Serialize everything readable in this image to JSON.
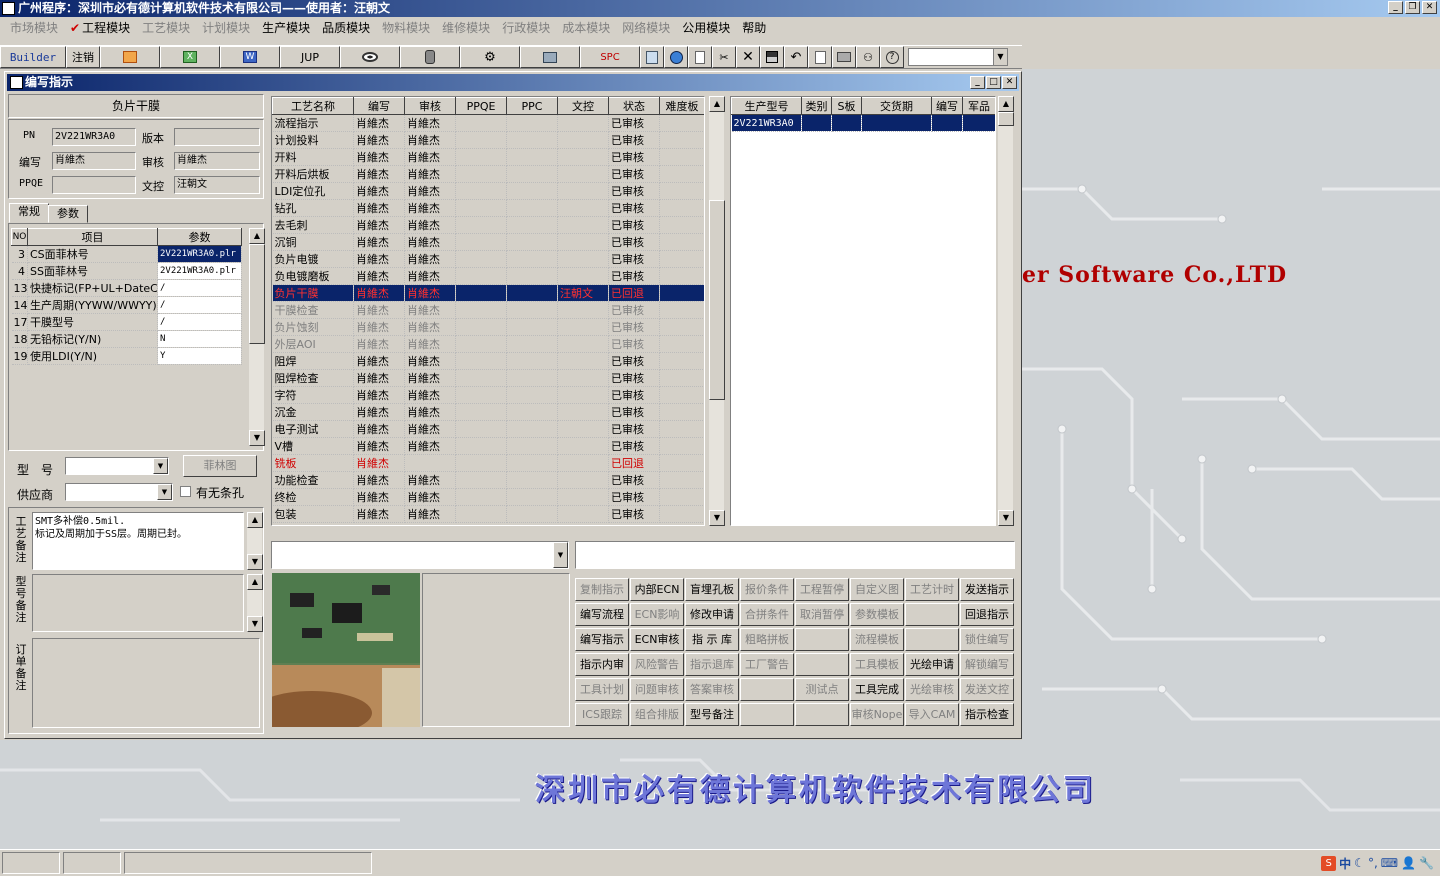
{
  "app": {
    "title": "广州程序：深圳市必有德计算机软件技术有限公司——使用者：汪朝文"
  },
  "menubar": [
    {
      "label": "市场模块",
      "enabled": false
    },
    {
      "label": "工程模块",
      "enabled": true,
      "checked": true
    },
    {
      "label": "工艺模块",
      "enabled": false
    },
    {
      "label": "计划模块",
      "enabled": false
    },
    {
      "label": "生产模块",
      "enabled": true
    },
    {
      "label": "品质模块",
      "enabled": true
    },
    {
      "label": "物料模块",
      "enabled": false
    },
    {
      "label": "维修模块",
      "enabled": false
    },
    {
      "label": "行政模块",
      "enabled": false
    },
    {
      "label": "成本模块",
      "enabled": false
    },
    {
      "label": "网络模块",
      "enabled": false
    },
    {
      "label": "公用模块",
      "enabled": true
    },
    {
      "label": "帮助",
      "enabled": true
    }
  ],
  "toolbar": {
    "builder": "Builder",
    "logout": "注销",
    "jup": "JUP",
    "spc": "SPC"
  },
  "background": {
    "slogan": "er Software Co.,LTD",
    "company": "深圳市必有德计算机软件技术有限公司"
  },
  "window": {
    "title": "编写指示"
  },
  "left": {
    "header": "负片干膜",
    "pn_label": "PN",
    "pn": "2V221WR3A0",
    "version_label": "版本",
    "version": "",
    "writer_label": "编写",
    "writer": "肖維杰",
    "reviewer_label": "审核",
    "reviewer": "肖維杰",
    "ppqe_label": "PPQE",
    "ppqe": "",
    "doc_label": "文控",
    "doc": "汪朝文",
    "tabs": [
      "常规",
      "参数"
    ],
    "param_headers": [
      "NO",
      "项目",
      "参数"
    ],
    "params": [
      {
        "no": "3",
        "item": "CS面菲林号",
        "value": "2V221WR3A0.plr",
        "sel": true
      },
      {
        "no": "4",
        "item": "SS面菲林号",
        "value": "2V221WR3A0.plr"
      },
      {
        "no": "13",
        "item": "快捷标记(FP+UL+DateC",
        "value": "/"
      },
      {
        "no": "14",
        "item": "生产周期(YYWW/WWYY)",
        "value": "/"
      },
      {
        "no": "17",
        "item": "干膜型号",
        "value": "/"
      },
      {
        "no": "18",
        "item": "无铅标记(Y/N)",
        "value": "N"
      },
      {
        "no": "19",
        "item": "使用LDI(Y/N)",
        "value": "Y"
      }
    ],
    "model_label": "型　号",
    "model": "",
    "film_button": "菲林图",
    "supplier_label": "供应商",
    "supplier": "",
    "slot_label": "有无条孔",
    "process_note_label": "工艺备注",
    "process_note": "SMT多补偿0.5mil.\n标记及周期加于SS层。周期已封。",
    "model_note_label": "型号备注",
    "order_note_label": "订单备注"
  },
  "process_grid": {
    "headers": [
      "工艺名称",
      "编写",
      "审核",
      "PPQE",
      "PPC",
      "文控",
      "状态",
      "难度板"
    ],
    "rows": [
      {
        "name": "流程指示",
        "writer": "肖維杰",
        "reviewer": "肖維杰",
        "ppqe": "",
        "ppc": "",
        "doc": "",
        "status": "已审核",
        "style": ""
      },
      {
        "name": "计划投料",
        "writer": "肖維杰",
        "reviewer": "肖維杰",
        "ppqe": "",
        "ppc": "",
        "doc": "",
        "status": "已审核",
        "style": ""
      },
      {
        "name": "开料",
        "writer": "肖維杰",
        "reviewer": "肖維杰",
        "ppqe": "",
        "ppc": "",
        "doc": "",
        "status": "已审核",
        "style": ""
      },
      {
        "name": "开料后烘板",
        "writer": "肖維杰",
        "reviewer": "肖維杰",
        "ppqe": "",
        "ppc": "",
        "doc": "",
        "status": "已审核",
        "style": ""
      },
      {
        "name": "LDI定位孔",
        "writer": "肖維杰",
        "reviewer": "肖維杰",
        "ppqe": "",
        "ppc": "",
        "doc": "",
        "status": "已审核",
        "style": ""
      },
      {
        "name": "钻孔",
        "writer": "肖維杰",
        "reviewer": "肖維杰",
        "ppqe": "",
        "ppc": "",
        "doc": "",
        "status": "已审核",
        "style": ""
      },
      {
        "name": "去毛刺",
        "writer": "肖維杰",
        "reviewer": "肖維杰",
        "ppqe": "",
        "ppc": "",
        "doc": "",
        "status": "已审核",
        "style": ""
      },
      {
        "name": "沉铜",
        "writer": "肖維杰",
        "reviewer": "肖維杰",
        "ppqe": "",
        "ppc": "",
        "doc": "",
        "status": "已审核",
        "style": ""
      },
      {
        "name": "负片电镀",
        "writer": "肖維杰",
        "reviewer": "肖維杰",
        "ppqe": "",
        "ppc": "",
        "doc": "",
        "status": "已审核",
        "style": ""
      },
      {
        "name": "负电镀磨板",
        "writer": "肖維杰",
        "reviewer": "肖維杰",
        "ppqe": "",
        "ppc": "",
        "doc": "",
        "status": "已审核",
        "style": ""
      },
      {
        "name": "负片干膜",
        "writer": "肖維杰",
        "reviewer": "肖維杰",
        "ppqe": "",
        "ppc": "",
        "doc": "汪朝文",
        "status": "已回退",
        "style": "sel"
      },
      {
        "name": "干膜检查",
        "writer": "肖維杰",
        "reviewer": "肖維杰",
        "ppqe": "",
        "ppc": "",
        "doc": "",
        "status": "已审核",
        "style": "gray"
      },
      {
        "name": "负片蚀刻",
        "writer": "肖維杰",
        "reviewer": "肖維杰",
        "ppqe": "",
        "ppc": "",
        "doc": "",
        "status": "已审核",
        "style": "gray"
      },
      {
        "name": "外层AOI",
        "writer": "肖維杰",
        "reviewer": "肖維杰",
        "ppqe": "",
        "ppc": "",
        "doc": "",
        "status": "已审核",
        "style": "gray"
      },
      {
        "name": "阻焊",
        "writer": "肖維杰",
        "reviewer": "肖維杰",
        "ppqe": "",
        "ppc": "",
        "doc": "",
        "status": "已审核",
        "style": ""
      },
      {
        "name": "阻焊检查",
        "writer": "肖維杰",
        "reviewer": "肖維杰",
        "ppqe": "",
        "ppc": "",
        "doc": "",
        "status": "已审核",
        "style": ""
      },
      {
        "name": "字符",
        "writer": "肖維杰",
        "reviewer": "肖維杰",
        "ppqe": "",
        "ppc": "",
        "doc": "",
        "status": "已审核",
        "style": ""
      },
      {
        "name": "沉金",
        "writer": "肖維杰",
        "reviewer": "肖維杰",
        "ppqe": "",
        "ppc": "",
        "doc": "",
        "status": "已审核",
        "style": ""
      },
      {
        "name": "电子测试",
        "writer": "肖維杰",
        "reviewer": "肖維杰",
        "ppqe": "",
        "ppc": "",
        "doc": "",
        "status": "已审核",
        "style": ""
      },
      {
        "name": "V槽",
        "writer": "肖維杰",
        "reviewer": "肖維杰",
        "ppqe": "",
        "ppc": "",
        "doc": "",
        "status": "已审核",
        "style": ""
      },
      {
        "name": "铣板",
        "writer": "肖維杰",
        "reviewer": "",
        "ppqe": "",
        "ppc": "",
        "doc": "",
        "status": "已回退",
        "style": "red"
      },
      {
        "name": "功能检查",
        "writer": "肖維杰",
        "reviewer": "肖維杰",
        "ppqe": "",
        "ppc": "",
        "doc": "",
        "status": "已审核",
        "style": ""
      },
      {
        "name": "终检",
        "writer": "肖維杰",
        "reviewer": "肖維杰",
        "ppqe": "",
        "ppc": "",
        "doc": "",
        "status": "已审核",
        "style": ""
      },
      {
        "name": "包装",
        "writer": "肖維杰",
        "reviewer": "肖維杰",
        "ppqe": "",
        "ppc": "",
        "doc": "",
        "status": "已审核",
        "style": ""
      }
    ]
  },
  "model_grid": {
    "headers": [
      "生产型号",
      "类别",
      "S板",
      "交货期",
      "编写",
      "军品"
    ],
    "rows": [
      {
        "model": "2V221WR3A0",
        "type": "",
        "sboard": "",
        "delivery": "",
        "writer": "",
        "military": ""
      }
    ]
  },
  "actions": [
    {
      "label": "复制指示",
      "enabled": false
    },
    {
      "label": "内部ECN",
      "enabled": true
    },
    {
      "label": "盲埋孔板",
      "enabled": true
    },
    {
      "label": "报价条件",
      "enabled": false
    },
    {
      "label": "工程暂停",
      "enabled": false
    },
    {
      "label": "自定义图",
      "enabled": false
    },
    {
      "label": "工艺计时",
      "enabled": false
    },
    {
      "label": "发送指示",
      "enabled": true
    },
    {
      "label": "编写流程",
      "enabled": true
    },
    {
      "label": "ECN影响",
      "enabled": false
    },
    {
      "label": "修改申请",
      "enabled": true
    },
    {
      "label": "合拼条件",
      "enabled": false
    },
    {
      "label": "取消暂停",
      "enabled": false
    },
    {
      "label": "参数模板",
      "enabled": false
    },
    {
      "label": "",
      "enabled": false
    },
    {
      "label": "回退指示",
      "enabled": true
    },
    {
      "label": "编写指示",
      "enabled": true
    },
    {
      "label": "ECN审核",
      "enabled": true
    },
    {
      "label": "指 示 库",
      "enabled": true
    },
    {
      "label": "粗略拼板",
      "enabled": false
    },
    {
      "label": "",
      "enabled": false
    },
    {
      "label": "流程模板",
      "enabled": false
    },
    {
      "label": "",
      "enabled": false
    },
    {
      "label": "锁住编写",
      "enabled": false
    },
    {
      "label": "指示内审",
      "enabled": true
    },
    {
      "label": "风险警告",
      "enabled": false
    },
    {
      "label": "指示退库",
      "enabled": false
    },
    {
      "label": "工厂警告",
      "enabled": false
    },
    {
      "label": "",
      "enabled": false
    },
    {
      "label": "工具模板",
      "enabled": false
    },
    {
      "label": "光绘申请",
      "enabled": true
    },
    {
      "label": "解锁编写",
      "enabled": false
    },
    {
      "label": "工具计划",
      "enabled": false
    },
    {
      "label": "问题审核",
      "enabled": false
    },
    {
      "label": "答案审核",
      "enabled": false
    },
    {
      "label": "",
      "enabled": false
    },
    {
      "label": "测试点",
      "enabled": false
    },
    {
      "label": "工具完成",
      "enabled": true
    },
    {
      "label": "光绘审核",
      "enabled": false
    },
    {
      "label": "发送文控",
      "enabled": false
    },
    {
      "label": "ICS跟踪",
      "enabled": false
    },
    {
      "label": "组合排版",
      "enabled": false
    },
    {
      "label": "型号备注",
      "enabled": true
    },
    {
      "label": "",
      "enabled": false
    },
    {
      "label": "",
      "enabled": false
    },
    {
      "label": "审核Nope",
      "enabled": false
    },
    {
      "label": "导入CAM",
      "enabled": false
    },
    {
      "label": "指示检查",
      "enabled": true
    }
  ],
  "tray": {
    "ime": "中"
  }
}
